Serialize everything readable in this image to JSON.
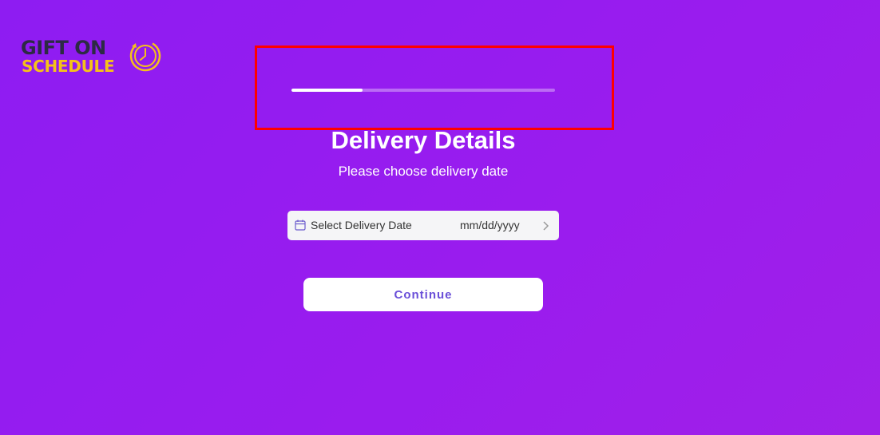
{
  "logo": {
    "line1": "GIFT ON",
    "line2": "SCHEDULE",
    "icon": "clock-icon"
  },
  "progress": {
    "value_fraction": 0.27
  },
  "heading": {
    "title": "Delivery Details",
    "subtitle": "Please choose delivery date"
  },
  "date_picker": {
    "icon": "calendar-icon",
    "label": "Select Delivery Date",
    "placeholder": "mm/dd/yyyy",
    "chevron": "chevron-right-icon"
  },
  "actions": {
    "continue_label": "Continue"
  },
  "colors": {
    "background": "#8e1cf2",
    "logo_dark": "#2d2a44",
    "logo_accent": "#f5c11a",
    "highlight": "#ff0000",
    "button_text": "#6a4fd8"
  }
}
